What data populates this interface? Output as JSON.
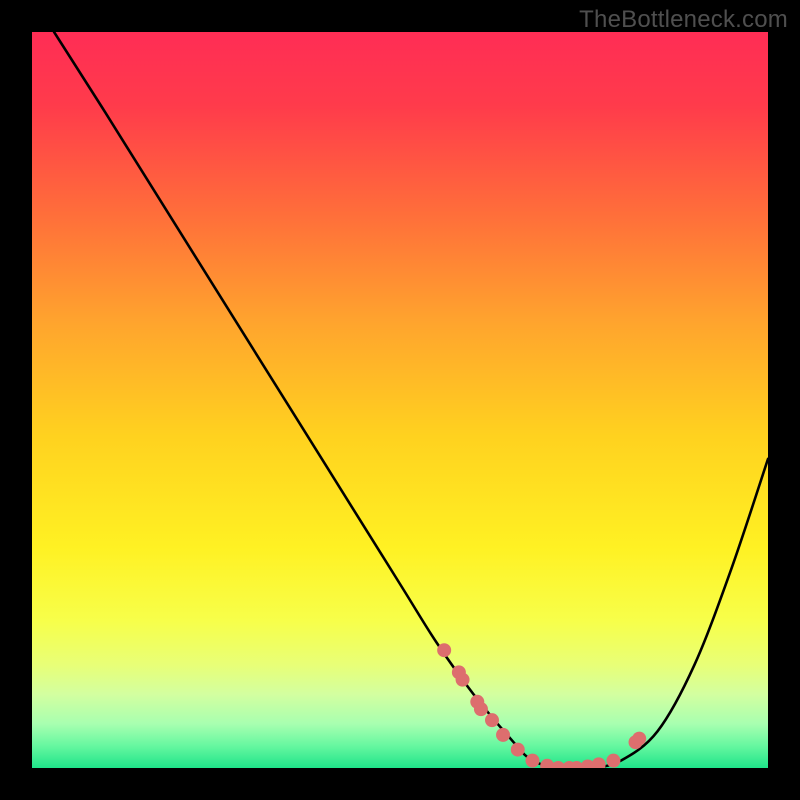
{
  "watermark": "TheBottleneck.com",
  "chart_data": {
    "type": "line",
    "title": "",
    "xlabel": "",
    "ylabel": "",
    "xlim": [
      0,
      100
    ],
    "ylim": [
      0,
      100
    ],
    "curve": {
      "name": "bottleneck-curve",
      "x": [
        3,
        10,
        20,
        30,
        40,
        50,
        55,
        60,
        65,
        68,
        72,
        76,
        80,
        85,
        90,
        95,
        100
      ],
      "y": [
        100,
        89,
        73,
        57,
        41,
        25,
        17,
        10,
        4,
        1,
        0,
        0,
        1,
        5,
        14,
        27,
        42
      ]
    },
    "markers": {
      "name": "highlight-points",
      "color": "#dd6e6e",
      "x": [
        56,
        58,
        58.5,
        60.5,
        61,
        62.5,
        64,
        66,
        68,
        70,
        71.5,
        73,
        74,
        75.5,
        77,
        79,
        82,
        82.5
      ],
      "y": [
        16,
        13,
        12,
        9,
        8,
        6.5,
        4.5,
        2.5,
        1,
        0.3,
        0,
        0,
        0,
        0.2,
        0.5,
        1,
        3.5,
        4
      ]
    },
    "background_gradient": {
      "stops": [
        {
          "offset": 0.0,
          "color": "#ff2d55"
        },
        {
          "offset": 0.1,
          "color": "#ff3b4b"
        },
        {
          "offset": 0.25,
          "color": "#ff6f3a"
        },
        {
          "offset": 0.4,
          "color": "#ffa62d"
        },
        {
          "offset": 0.55,
          "color": "#ffd21f"
        },
        {
          "offset": 0.7,
          "color": "#fff123"
        },
        {
          "offset": 0.8,
          "color": "#f7ff4a"
        },
        {
          "offset": 0.86,
          "color": "#e8ff77"
        },
        {
          "offset": 0.9,
          "color": "#d3ffa0"
        },
        {
          "offset": 0.94,
          "color": "#a8ffb0"
        },
        {
          "offset": 0.97,
          "color": "#66f7a0"
        },
        {
          "offset": 1.0,
          "color": "#1fe48a"
        }
      ]
    }
  }
}
